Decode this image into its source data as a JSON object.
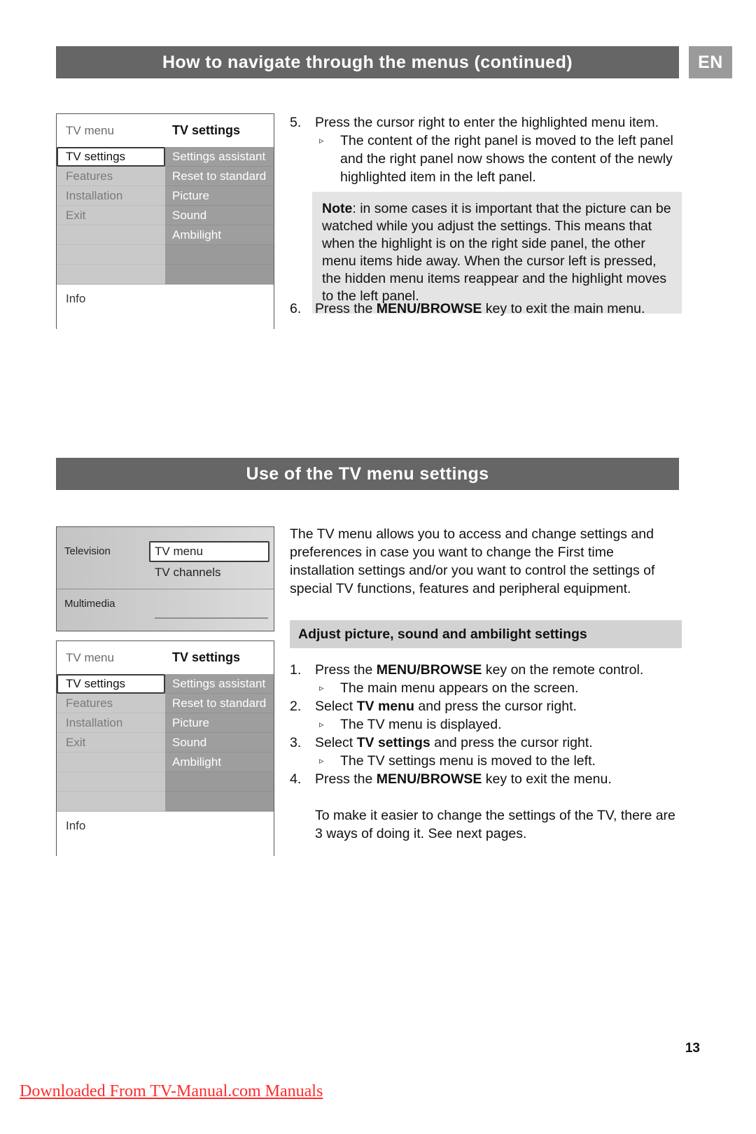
{
  "document": {
    "page_number": "13",
    "language_badge": "EN",
    "watermark": "Downloaded From TV-Manual.com Manuals"
  },
  "section1": {
    "banner_title": "How to navigate through the menus  (continued)",
    "osd_menu": {
      "header_left": "TV menu",
      "header_right": "TV settings",
      "left_items": [
        "TV settings",
        "Features",
        "Installation",
        "Exit"
      ],
      "right_items": [
        "Settings assistant",
        "Reset to standard",
        "Picture",
        "Sound",
        "Ambilight"
      ],
      "footer": "Info"
    },
    "step5": {
      "number": "5.",
      "text": "Press the cursor right to enter the highlighted menu item.",
      "sub_marker": "▹",
      "sub_text": "The content of the right panel is moved to the left panel and the right panel now shows the content of the newly highlighted item in the left panel."
    },
    "note": {
      "label": "Note",
      "separator": ": ",
      "text": "in some cases it is important that the picture can be watched while you adjust the settings. This means that when the highlight is on the right side panel, the other menu items hide away. When the cursor left is pressed, the hidden menu items reappear and the highlight moves to the left panel."
    },
    "step6": {
      "number": "6.",
      "text_before": "Press the ",
      "key": "MENU/BROWSE",
      "text_after": " key to exit the main menu."
    }
  },
  "section2": {
    "banner_title": "Use of the TV menu settings",
    "browse_panel": {
      "television_label": "Television",
      "television_items": [
        "TV menu",
        "TV channels"
      ],
      "television_selected": "TV menu",
      "multimedia_label": "Multimedia"
    },
    "osd_menu": {
      "header_left": "TV menu",
      "header_right": "TV settings",
      "left_items": [
        "TV settings",
        "Features",
        "Installation",
        "Exit"
      ],
      "right_items": [
        "Settings assistant",
        "Reset to standard",
        "Picture",
        "Sound",
        "Ambilight"
      ],
      "footer": "Info"
    },
    "intro": "The TV menu allows you to access and change settings and preferences in case you want to change the First time installation settings and/or you want to control the settings of special TV functions, features and peripheral equipment.",
    "subhead": "Adjust picture, sound and ambilight settings",
    "steps": [
      {
        "number": "1.",
        "text_before": "Press the ",
        "key": "MENU/BROWSE",
        "text_after": " key on the remote control.",
        "sub_marker": "▹",
        "sub_text": "The main menu appears on the screen."
      },
      {
        "number": "2.",
        "text_before": "Select ",
        "key": "TV menu",
        "text_after": " and press the cursor right.",
        "sub_marker": "▹",
        "sub_text": "The TV menu is displayed."
      },
      {
        "number": "3.",
        "text_before": "Select ",
        "key": "TV settings",
        "text_after": " and press the cursor right.",
        "sub_marker": "▹",
        "sub_text": "The TV settings menu is moved to the left."
      },
      {
        "number": "4.",
        "text_before": "Press the ",
        "key": "MENU/BROWSE",
        "text_after": " key to exit the menu.",
        "sub_marker": "",
        "sub_text": ""
      }
    ],
    "closing": "To make it easier to change the settings of the TV, there are 3 ways of doing it. See next pages."
  },
  "colors": {
    "banner_bg": "#666666",
    "badge_bg": "#9a9a9a",
    "note_bg": "#e4e4e4",
    "subhead_bg": "#d2d2d2",
    "watermark": "#ff2a2a",
    "osd_left_bg": "#c9c9c9",
    "osd_right_bg": "#9e9e9e"
  }
}
